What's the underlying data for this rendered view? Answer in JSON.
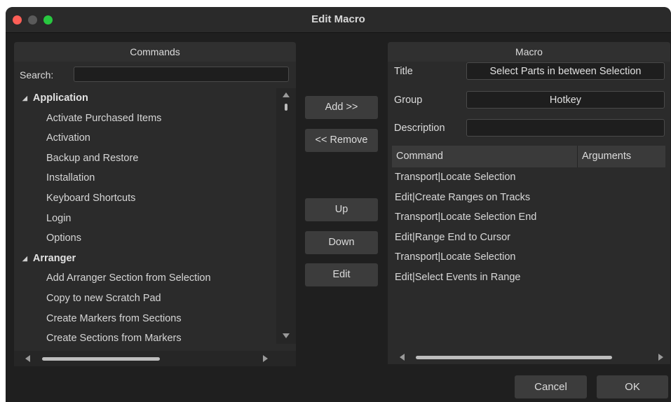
{
  "window": {
    "title": "Edit Macro"
  },
  "commands": {
    "header": "Commands",
    "search_label": "Search:",
    "search_value": "",
    "groups": [
      {
        "name": "Application",
        "items": [
          "Activate Purchased Items",
          "Activation",
          "Backup and Restore",
          "Installation",
          "Keyboard Shortcuts",
          "Login",
          "Options"
        ]
      },
      {
        "name": "Arranger",
        "items": [
          "Add Arranger Section from Selection",
          "Copy to new Scratch Pad",
          "Create Markers from Sections",
          "Create Sections from Markers"
        ]
      }
    ]
  },
  "middle_buttons": {
    "add": "Add >>",
    "remove": "<< Remove",
    "up": "Up",
    "down": "Down",
    "edit": "Edit"
  },
  "macro": {
    "header": "Macro",
    "title_label": "Title",
    "title_value": "Select Parts in between Selection",
    "group_label": "Group",
    "group_value": "Hotkey",
    "description_label": "Description",
    "description_value": "",
    "columns": {
      "command": "Command",
      "arguments": "Arguments"
    },
    "rows": [
      "Transport|Locate Selection",
      "Edit|Create Ranges on Tracks",
      "Transport|Locate Selection End",
      "Edit|Range End to Cursor",
      "Transport|Locate Selection",
      "Edit|Select Events in Range"
    ]
  },
  "footer": {
    "cancel": "Cancel",
    "ok": "OK"
  },
  "colors": {
    "window_bg": "#1f1f1f",
    "panel_bg": "#2b2b2b",
    "button_bg": "#3c3c3c",
    "close": "#fe5f57",
    "minimize": "#5a5a5a",
    "maximize": "#28c840"
  }
}
